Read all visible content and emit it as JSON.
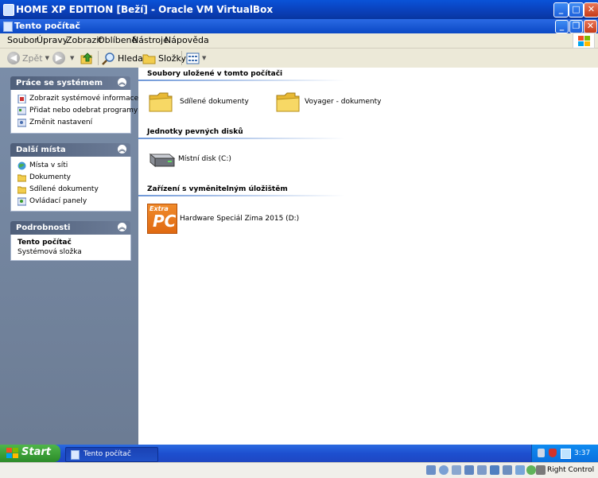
{
  "vbox_window": {
    "title": "HOME XP EDITION [Beží] - Oracle VM VirtualBox"
  },
  "explorer_window": {
    "title": "Tento počítač"
  },
  "menu": [
    "Soubor",
    "Úpravy",
    "Zobrazit",
    "Oblíbené",
    "Nástroje",
    "Nápověda"
  ],
  "toolbar": {
    "back_label": "Zpět",
    "search_label": "Hledat",
    "folders_label": "Složky"
  },
  "left_panel": {
    "system_tasks": {
      "title": "Práce se systémem",
      "items": [
        "Zobrazit systémové informace",
        "Přidat nebo odebrat programy",
        "Změnit nastavení"
      ]
    },
    "other_places": {
      "title": "Další místa",
      "items": [
        "Místa v síti",
        "Dokumenty",
        "Sdílené dokumenty",
        "Ovládací panely"
      ]
    },
    "details": {
      "title": "Podrobnosti",
      "name": "Tento počítač",
      "type": "Systémová složka"
    }
  },
  "content": {
    "sections": [
      {
        "title": "Soubory uložené v tomto počítači",
        "items": [
          "Sdílené dokumenty",
          "Voyager - dokumenty"
        ]
      },
      {
        "title": "Jednotky pevných disků",
        "items": [
          "Místní disk (C:)"
        ]
      },
      {
        "title": "Zařízení s vyměnitelným úložištěm",
        "items": [
          "Hardware Speciál Zima 2015 (D:)"
        ]
      }
    ],
    "cd_logo_top": "Extra",
    "cd_logo_bottom": "PC"
  },
  "taskbar": {
    "start_label": "Start",
    "window_button": "Tento počítač",
    "clock": "3:37"
  },
  "statusbar": {
    "host_key": "Right Control"
  },
  "colors": {
    "title_bar": "#0a47c6",
    "left_panel": "#72839d",
    "taskbar": "#1f50cf",
    "start": "#379c33",
    "folder": "#f2cd4e"
  }
}
